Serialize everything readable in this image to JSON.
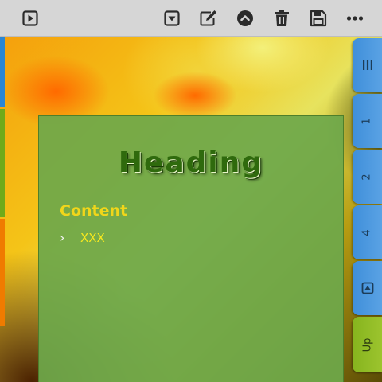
{
  "toolbar": {
    "icons": [
      "play-icon",
      "dropdown-icon",
      "edit-icon",
      "chevron-up-circle-icon",
      "trash-icon",
      "save-icon",
      "more-icon"
    ]
  },
  "panel": {
    "heading": "Heading",
    "content_title": "Content",
    "items": [
      {
        "label": "XXX"
      }
    ]
  },
  "side_tabs": [
    {
      "label": "|||",
      "icon": "menu-icon"
    },
    {
      "label": "1"
    },
    {
      "label": "2"
    },
    {
      "label": "4"
    },
    {
      "label": "",
      "icon": "play-icon"
    },
    {
      "label": "Up"
    }
  ],
  "colors": {
    "toolbar": "#d6d6d6",
    "panel": "#6ea84a",
    "heading": "#2f6a0d",
    "content_title": "#f1d61a",
    "item_text": "#f6e81e",
    "tab_blue": "#4a96dd",
    "tab_green": "#8fba24"
  }
}
